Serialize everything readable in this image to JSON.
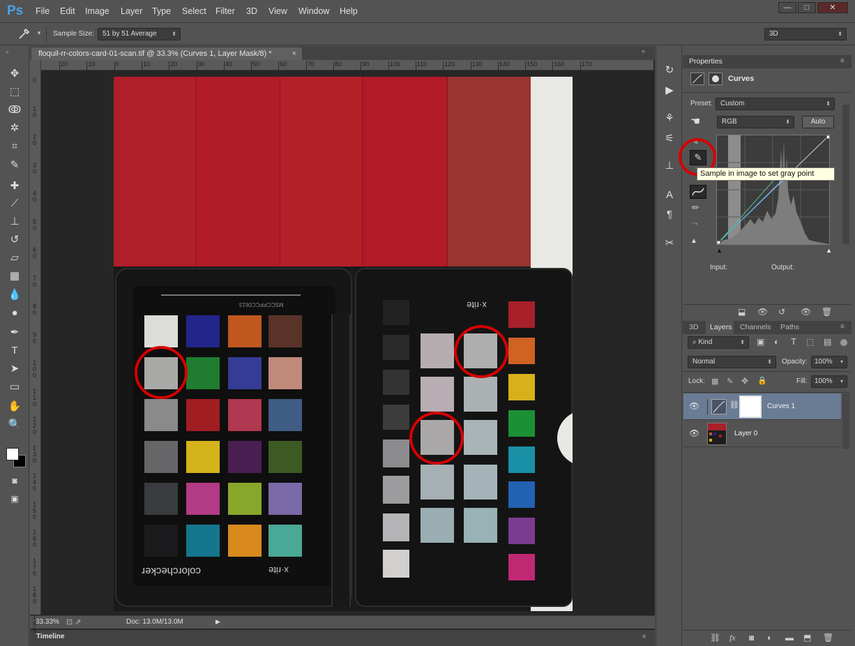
{
  "app": {
    "logo": "Ps"
  },
  "menu": [
    "File",
    "Edit",
    "Image",
    "Layer",
    "Type",
    "Select",
    "Filter",
    "3D",
    "View",
    "Window",
    "Help"
  ],
  "window_controls": {
    "minimize": "—",
    "maximize": "□",
    "close": "✕"
  },
  "options_bar": {
    "sample_size_label": "Sample Size:",
    "sample_size_value": "51 by 51 Average",
    "workspace": "3D"
  },
  "document": {
    "tab_title": "floquil-rr-colors-card-01-scan.tif @ 33.3% (Curves 1, Layer Mask/8) *",
    "close": "×",
    "zoom": "33.33%",
    "doc_info": "Doc: 13.0M/13.0M"
  },
  "ruler_top": [
    "20",
    "10",
    "0",
    "10",
    "20",
    "30",
    "40",
    "50",
    "60",
    "70",
    "80",
    "90",
    "100",
    "110",
    "120",
    "130",
    "140",
    "150",
    "160",
    "170"
  ],
  "ruler_left": [
    "0",
    "1 0",
    "2 0",
    "3 0",
    "4 0",
    "5 0",
    "6 0",
    "7 0",
    "8 0",
    "9 0",
    "1 0 0",
    "1 1 0",
    "1 2 0",
    "1 3 0",
    "1 4 0",
    "1 5 0",
    "1 6 0",
    "1 7 0",
    "1 8 0",
    "1 9 0"
  ],
  "canvas_text": {
    "colorchecker": "colorchecker",
    "xrite_left": "x·rite",
    "xrite_right": "x·rite",
    "serial": "MSCCPPCC0613"
  },
  "timeline": {
    "label": "Timeline"
  },
  "properties": {
    "tab": "Properties",
    "adjustment": "Curves",
    "preset_label": "Preset:",
    "preset_value": "Custom",
    "channel_value": "RGB",
    "auto_label": "Auto",
    "input_label": "Input:",
    "output_label": "Output:",
    "tooltip": "Sample in image to set gray point"
  },
  "layers_panel": {
    "tabs": [
      "3D",
      "Layers",
      "Channels",
      "Paths"
    ],
    "kind_label": "Kind",
    "blend_mode": "Normal",
    "opacity_label": "Opacity:",
    "opacity_value": "100%",
    "lock_label": "Lock:",
    "fill_label": "Fill:",
    "fill_value": "100%",
    "layers": [
      {
        "name": "Curves 1",
        "selected": true
      },
      {
        "name": "Layer 0",
        "selected": false
      }
    ]
  },
  "colors": {
    "accent": "#4aa3e8",
    "selection": "#6a7c94",
    "annotation_circle": "#d60000"
  }
}
